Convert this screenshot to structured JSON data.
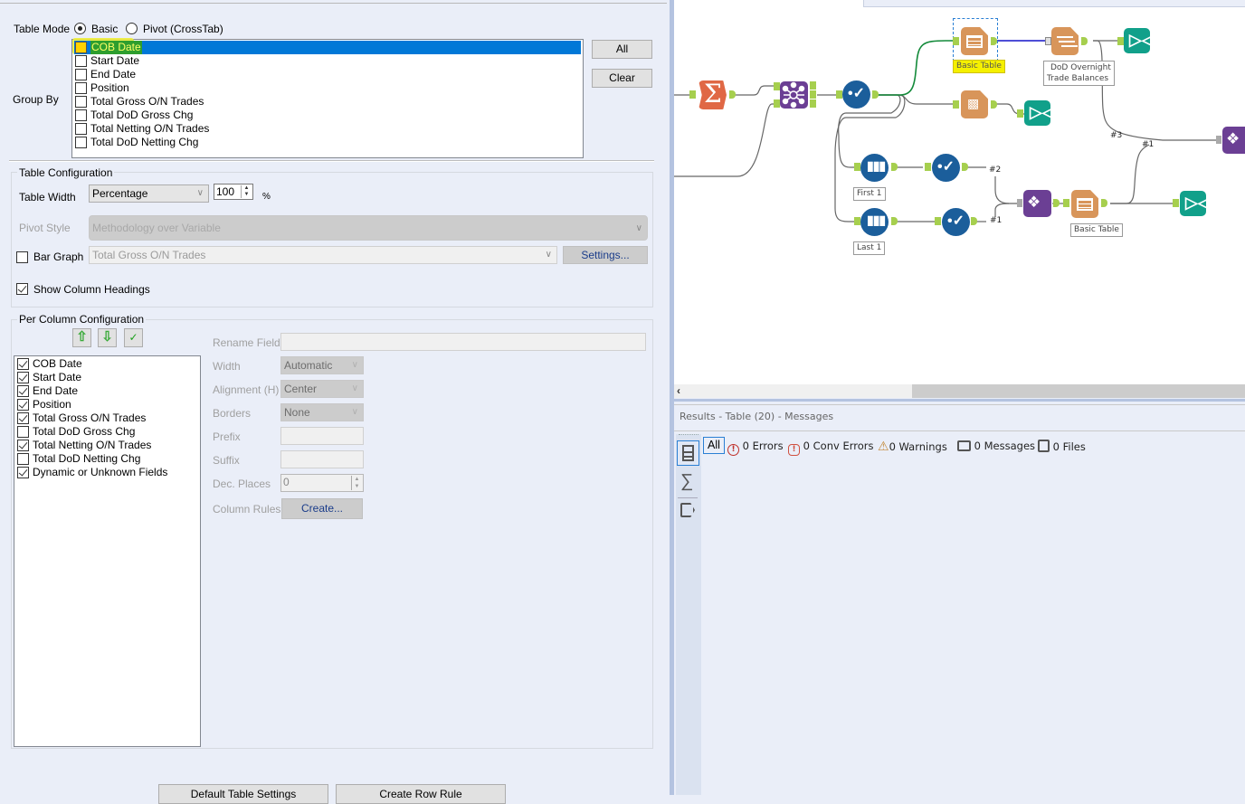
{
  "config": {
    "table_mode": {
      "label": "Table Mode",
      "options": [
        {
          "label": "Basic",
          "selected": true
        },
        {
          "label": "Pivot (CrossTab)",
          "selected": false
        }
      ]
    },
    "group_by": {
      "label": "Group By",
      "items": [
        {
          "label": "COB Date",
          "checked": false,
          "selected": true
        },
        {
          "label": "Start Date",
          "checked": false
        },
        {
          "label": "End Date",
          "checked": false
        },
        {
          "label": "Position",
          "checked": false
        },
        {
          "label": "Total Gross O/N Trades",
          "checked": false
        },
        {
          "label": "Total DoD Gross  Chg",
          "checked": false
        },
        {
          "label": "Total Netting O/N Trades",
          "checked": false
        },
        {
          "label": "Total DoD Netting Chg",
          "checked": false
        }
      ],
      "all_button": "All",
      "clear_button": "Clear"
    },
    "table_configuration": {
      "title": "Table Configuration",
      "table_width_label": "Table Width",
      "table_width_mode": "Percentage",
      "table_width_value": "100",
      "table_width_unit": "%",
      "pivot_style_label": "Pivot Style",
      "pivot_style_value": "Methodology over Variable",
      "bar_graph_label": "Bar Graph",
      "bar_graph_checked": false,
      "bar_graph_field": "Total Gross O/N Trades",
      "settings_button": "Settings...",
      "show_headings_label": "Show Column Headings",
      "show_headings_checked": true
    },
    "per_column": {
      "title": "Per Column Configuration",
      "columns": [
        {
          "label": "COB Date",
          "checked": true
        },
        {
          "label": "Start Date",
          "checked": true
        },
        {
          "label": "End Date",
          "checked": true
        },
        {
          "label": "Position",
          "checked": true
        },
        {
          "label": "Total Gross O/N Trades",
          "checked": true
        },
        {
          "label": "Total DoD Gross  Chg",
          "checked": false
        },
        {
          "label": "Total Netting O/N Trades",
          "checked": true
        },
        {
          "label": "Total DoD Netting Chg",
          "checked": false
        },
        {
          "label": "Dynamic or Unknown Fields",
          "checked": true
        }
      ],
      "rename_field_label": "Rename Field",
      "rename_field_value": "",
      "width_label": "Width",
      "width_value": "Automatic",
      "alignment_label": "Alignment (H)",
      "alignment_value": "Center",
      "borders_label": "Borders",
      "borders_value": "None",
      "prefix_label": "Prefix",
      "prefix_value": "",
      "suffix_label": "Suffix",
      "suffix_value": "",
      "dec_places_label": "Dec. Places",
      "dec_places_value": "0",
      "column_rules_label": "Column Rules",
      "create_button": "Create..."
    },
    "bottom_buttons": {
      "default_table_settings": "Default Table Settings",
      "create_row_rule": "Create Row Rule"
    }
  },
  "canvas": {
    "nodes": [
      {
        "name": "summarize-tool",
        "label": ""
      },
      {
        "name": "join-tool",
        "label": ""
      },
      {
        "name": "select-tool",
        "label": ""
      },
      {
        "name": "basic-table-tool",
        "label": "Basic Table",
        "highlighted": true
      },
      {
        "name": "layout-tool",
        "label": "DoD Overnight Trade Balances",
        "label_line1": "DoD Overnight",
        "label_line2": "Trade Balances"
      },
      {
        "name": "browse-tool-1",
        "label": ""
      },
      {
        "name": "report-tool",
        "label": ""
      },
      {
        "name": "browse-tool-2",
        "label": ""
      },
      {
        "name": "sample-first-tool",
        "label": "First 1"
      },
      {
        "name": "select-tool-2",
        "label": ""
      },
      {
        "name": "sample-last-tool",
        "label": "Last 1"
      },
      {
        "name": "select-tool-3",
        "label": ""
      },
      {
        "name": "union-tool",
        "label": ""
      },
      {
        "name": "basic-table-tool-2",
        "label": "Basic Table"
      },
      {
        "name": "browse-tool-3",
        "label": ""
      },
      {
        "name": "union-tool-2",
        "label": ""
      }
    ],
    "connection_labels": [
      "#2",
      "#1",
      "#3",
      "#1"
    ],
    "join_anchors": [
      "L",
      "R",
      "L",
      "J",
      "R"
    ]
  },
  "results": {
    "title": "Results - Table (20) - Messages",
    "filters": {
      "all": "All",
      "errors": "0 Errors",
      "conv_errors": "0 Conv Errors",
      "warnings": "0 Warnings",
      "messages": "0 Messages",
      "files": "0 Files"
    }
  },
  "colors": {
    "selection_blue": "#0078d7",
    "highlight_yellow": "#ffff00",
    "anchor_green": "#a6cf4e",
    "reporting_orange": "#d8955a",
    "join_purple": "#6b3f94",
    "preparation_blue": "#1b5e9b",
    "browse_teal": "#11a08a",
    "summarize_red": "#e06845"
  }
}
